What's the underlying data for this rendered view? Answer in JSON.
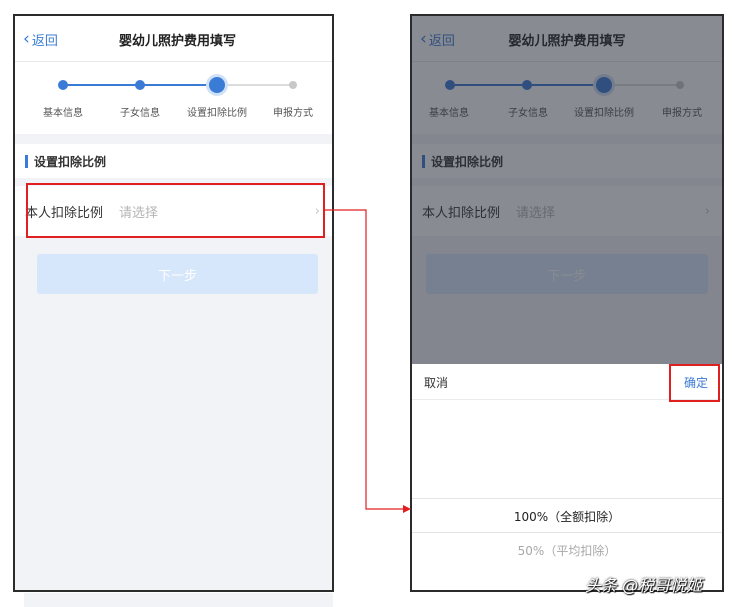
{
  "nav": {
    "back_label": "返回",
    "title": "婴幼儿照护费用填写"
  },
  "steps": [
    {
      "label": "基本信息",
      "state": "done"
    },
    {
      "label": "子女信息",
      "state": "done"
    },
    {
      "label": "设置扣除比例",
      "state": "current"
    },
    {
      "label": "申报方式",
      "state": "todo"
    }
  ],
  "section": {
    "title": "设置扣除比例"
  },
  "row": {
    "label": "本人扣除比例",
    "placeholder": "请选择",
    "arrow": "›"
  },
  "next_button": {
    "label": "下一步"
  },
  "sheet": {
    "cancel_label": "取消",
    "ok_label": "确定",
    "options": [
      "100%（全额扣除）",
      "50%（平均扣除）"
    ],
    "selected_index": 0
  },
  "watermark": "头条 @税哥悦姬",
  "colors": {
    "accent": "#3a7bd5",
    "highlight": "#e02020"
  }
}
